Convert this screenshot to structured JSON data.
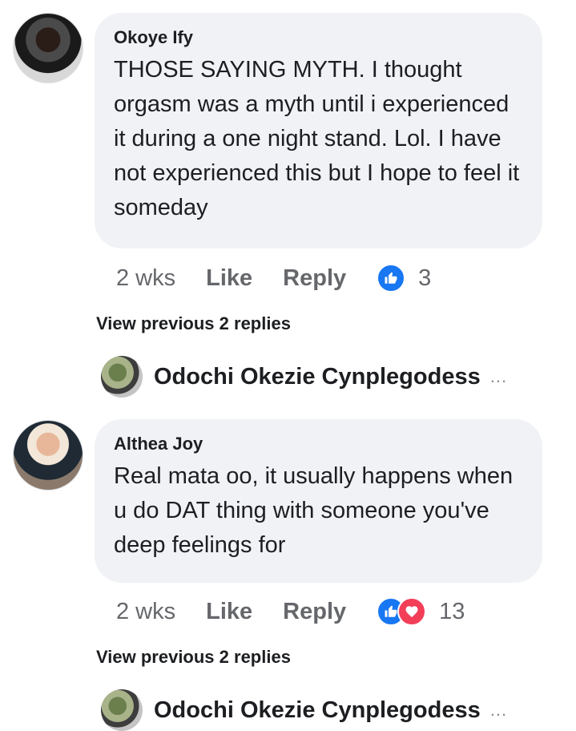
{
  "comments": [
    {
      "author": "Okoye Ify",
      "text": "THOSE SAYING MYTH. I thought orgasm was a myth until i experienced it during a one night stand. Lol. I have not experienced this but I hope to feel it someday",
      "time": "2 wks",
      "like_label": "Like",
      "reply_label": "Reply",
      "reaction_count": "3",
      "reactions": [
        "like-icon"
      ],
      "view_previous": "View previous 2 replies",
      "latest_reply_author": "Odochi Okezie Cynplegodess",
      "more_indicator": "..."
    },
    {
      "author": "Althea Joy",
      "text": "Real mata oo, it usually happens when u do DAT thing with someone you've deep feelings for",
      "time": "2 wks",
      "like_label": "Like",
      "reply_label": "Reply",
      "reaction_count": "13",
      "reactions": [
        "like-icon",
        "love-icon"
      ],
      "view_previous": "View previous 2 replies",
      "latest_reply_author": "Odochi Okezie Cynplegodess",
      "more_indicator": "..."
    }
  ],
  "colors": {
    "bubble": "#f0f2f5",
    "meta_text": "#65676b",
    "like_blue": "#1877f2",
    "love_red": "#f33e58"
  }
}
